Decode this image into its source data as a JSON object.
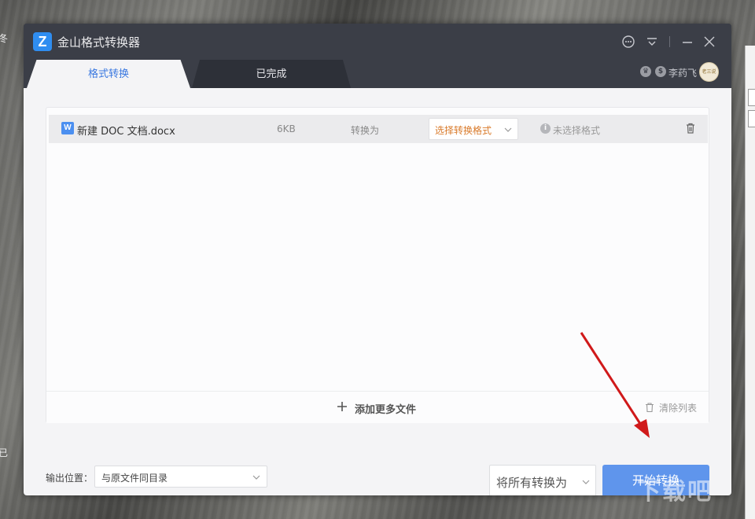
{
  "window": {
    "title": "金山格式转换器",
    "logo_letter": "Z"
  },
  "tabs": [
    {
      "label": "格式转换",
      "active": true
    },
    {
      "label": "已完成",
      "active": false
    }
  ],
  "user": {
    "name": "李药飞",
    "avatar_text": "老三说金钱的"
  },
  "file_list": {
    "rows": [
      {
        "icon": "W",
        "name": "新建 DOC 文档.docx",
        "size": "6KB",
        "convert_label": "转换为",
        "format_select": "选择转换格式",
        "status": "未选择格式"
      }
    ],
    "add_more_label": "添加更多文件",
    "clear_list_label": "清除列表"
  },
  "output": {
    "label": "输出位置：",
    "location": "与原文件同目录"
  },
  "convert_all": {
    "label": "将所有转换为"
  },
  "start_button": {
    "label": "开始转换"
  },
  "desktop": {
    "left_glyph_top": "冬",
    "left_glyph_bottom": "已"
  },
  "watermark": "下载吧",
  "colors": {
    "accent": "#3a78e0",
    "primary_button": "#5f95ec",
    "titlebar": "#3b3e47",
    "format_select_text": "#d97a2a",
    "annotation_arrow": "#d0191a"
  }
}
